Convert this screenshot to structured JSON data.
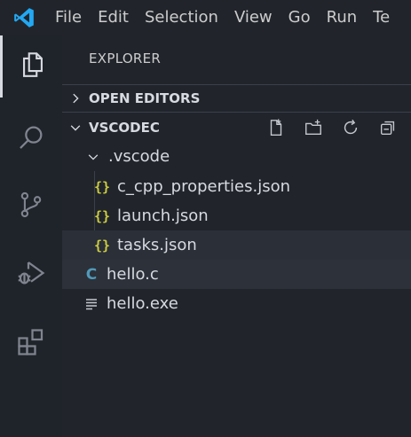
{
  "menu": [
    "File",
    "Edit",
    "Selection",
    "View",
    "Go",
    "Run",
    "Te"
  ],
  "activity_bar": {
    "items": [
      {
        "icon": "files-icon",
        "active": true
      },
      {
        "icon": "search-icon"
      },
      {
        "icon": "source-control-icon"
      },
      {
        "icon": "run-debug-icon"
      },
      {
        "icon": "extensions-icon"
      }
    ]
  },
  "explorer": {
    "title": "EXPLORER",
    "open_editors": "OPEN EDITORS",
    "folder": "VSCODEC",
    "tree": [
      {
        "label": ".vscode",
        "type": "folder",
        "depth": 1
      },
      {
        "label": "c_cpp_properties.json",
        "type": "json",
        "depth": 2
      },
      {
        "label": "launch.json",
        "type": "json",
        "depth": 2
      },
      {
        "label": "tasks.json",
        "type": "json",
        "depth": 2
      },
      {
        "label": "hello.c",
        "type": "c",
        "depth": 1
      },
      {
        "label": "hello.exe",
        "type": "exe",
        "depth": 1
      }
    ]
  },
  "colors": {
    "accent": "#007acc",
    "json": "#cbcb41",
    "c": "#519aba"
  }
}
